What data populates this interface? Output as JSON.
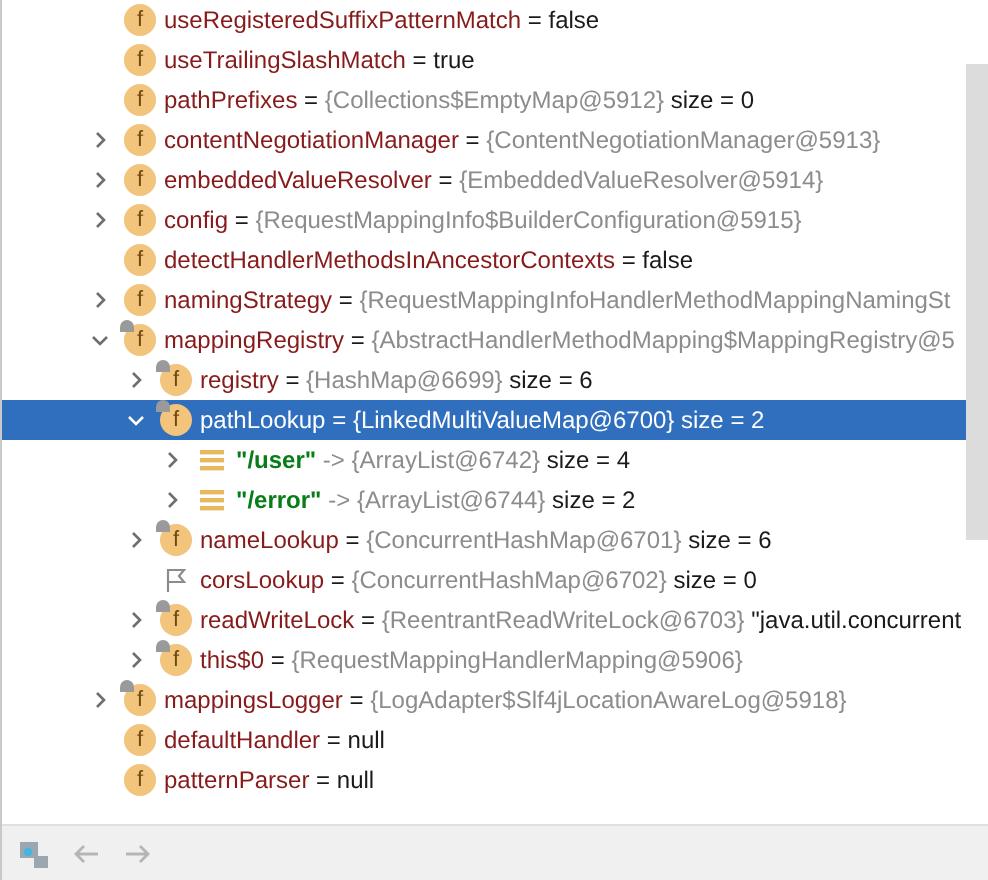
{
  "tree": [
    {
      "kind": "field",
      "letter": "f",
      "name": "useRegisteredSuffixPatternMatch",
      "op": "=",
      "value": "false",
      "literal": true,
      "expandable": false,
      "selected": false
    },
    {
      "kind": "field",
      "letter": "f",
      "name": "useTrailingSlashMatch",
      "op": "=",
      "value": "true",
      "literal": true,
      "expandable": false,
      "selected": false
    },
    {
      "kind": "field",
      "letter": "f",
      "name": "pathPrefixes",
      "op": "=",
      "value": "{Collections$EmptyMap@5912}",
      "literal": false,
      "size": "size = 0",
      "expandable": false,
      "selected": false
    },
    {
      "kind": "field",
      "letter": "f",
      "name": "contentNegotiationManager",
      "op": "=",
      "value": "{ContentNegotiationManager@5913}",
      "literal": false,
      "expandable": true,
      "expanded": false,
      "selected": false
    },
    {
      "kind": "field",
      "letter": "f",
      "name": "embeddedValueResolver",
      "op": "=",
      "value": "{EmbeddedValueResolver@5914}",
      "literal": false,
      "expandable": true,
      "expanded": false,
      "selected": false
    },
    {
      "kind": "field",
      "letter": "f",
      "name": "config",
      "op": "=",
      "value": "{RequestMappingInfo$BuilderConfiguration@5915}",
      "literal": false,
      "expandable": true,
      "expanded": false,
      "selected": false
    },
    {
      "kind": "field",
      "letter": "f",
      "name": "detectHandlerMethodsInAncestorContexts",
      "op": "=",
      "value": "false",
      "literal": true,
      "expandable": false,
      "selected": false
    },
    {
      "kind": "field",
      "letter": "f",
      "name": "namingStrategy",
      "op": "=",
      "value": "{RequestMappingInfoHandlerMethodMappingNamingSt",
      "literal": false,
      "expandable": true,
      "expanded": false,
      "selected": false
    },
    {
      "kind": "field-final",
      "letter": "f",
      "name": "mappingRegistry",
      "op": "=",
      "value": "{AbstractHandlerMethodMapping$MappingRegistry@5",
      "literal": false,
      "expandable": true,
      "expanded": true,
      "selected": false,
      "children": [
        {
          "kind": "field-final",
          "letter": "f",
          "name": "registry",
          "op": "=",
          "value": "{HashMap@6699}",
          "literal": false,
          "size": "size = 6",
          "expandable": true,
          "expanded": false,
          "selected": false
        },
        {
          "kind": "field-final",
          "letter": "f",
          "name": "pathLookup",
          "op": "=",
          "value": "{LinkedMultiValueMap@6700}",
          "size": "size = 2",
          "expandable": true,
          "expanded": true,
          "selected": true,
          "children": [
            {
              "kind": "entry",
              "name": "\"/user\"",
              "op": "->",
              "value": "{ArrayList@6742}",
              "literal": false,
              "size": "size = 4",
              "expandable": true,
              "expanded": false,
              "selected": false
            },
            {
              "kind": "entry",
              "name": "\"/error\"",
              "op": "->",
              "value": "{ArrayList@6744}",
              "literal": false,
              "size": "size = 2",
              "expandable": true,
              "expanded": false,
              "selected": false
            }
          ]
        },
        {
          "kind": "field-final",
          "letter": "f",
          "name": "nameLookup",
          "op": "=",
          "value": "{ConcurrentHashMap@6701}",
          "literal": false,
          "size": "size = 6",
          "expandable": true,
          "expanded": false,
          "selected": false
        },
        {
          "kind": "flag",
          "name": "corsLookup",
          "op": "=",
          "value": "{ConcurrentHashMap@6702}",
          "literal": false,
          "size": "size = 0",
          "expandable": false,
          "selected": false
        },
        {
          "kind": "field-final",
          "letter": "f",
          "name": "readWriteLock",
          "op": "=",
          "value": "{ReentrantReadWriteLock@6703}",
          "literal": false,
          "tail": "\"java.util.concurrent",
          "expandable": true,
          "expanded": false,
          "selected": false
        },
        {
          "kind": "field-final",
          "letter": "f",
          "name": "this$0",
          "op": "=",
          "value": "{RequestMappingHandlerMapping@5906}",
          "literal": false,
          "expandable": true,
          "expanded": false,
          "selected": false
        }
      ]
    },
    {
      "kind": "field-final",
      "letter": "f",
      "name": "mappingsLogger",
      "op": "=",
      "value": "{LogAdapter$Slf4jLocationAwareLog@5918}",
      "literal": false,
      "expandable": true,
      "expanded": false,
      "selected": false
    },
    {
      "kind": "field",
      "letter": "f",
      "name": "defaultHandler",
      "op": "=",
      "value": "null",
      "literal": true,
      "expandable": false,
      "selected": false
    },
    {
      "kind": "field",
      "letter": "f",
      "name": "patternParser",
      "op": "=",
      "value": "null",
      "literal": true,
      "expandable": false,
      "selected": false
    }
  ]
}
